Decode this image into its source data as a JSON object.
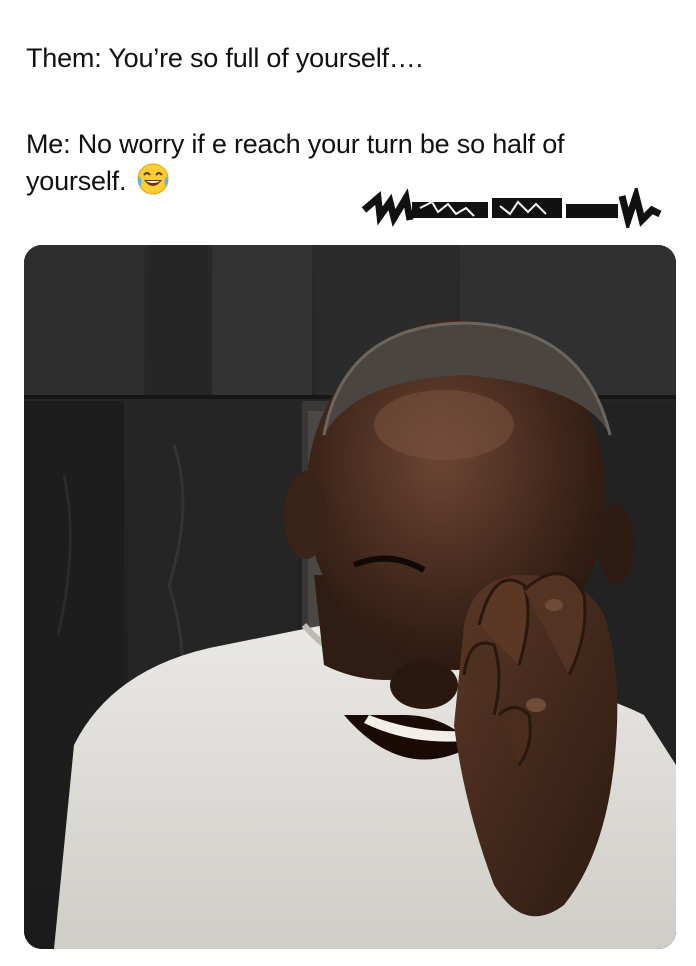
{
  "post": {
    "line1": "Them:  You’re so full of yourself….",
    "line2": "Me:  No worry if e reach your turn be so half of yourself.",
    "emoji": "face-with-tears-of-joy-emoji"
  },
  "watermark": {
    "icon": "scribbled-watermark-icon"
  },
  "photo": {
    "icon": "laughing-man-photo"
  }
}
